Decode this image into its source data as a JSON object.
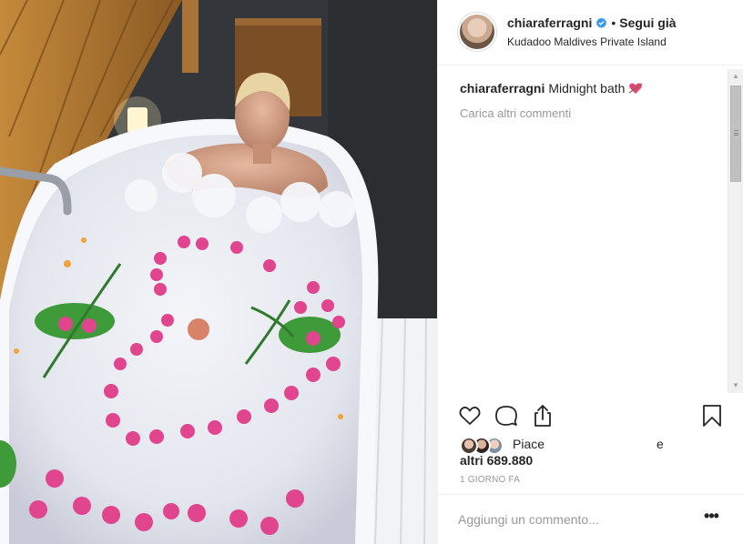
{
  "post": {
    "username": "chiaraferragni",
    "follow_separator": "•",
    "follow_label": "Segui già",
    "location": "Kudadoo Maldives Private Island",
    "caption_text": "Midnight bath",
    "load_more_label": "Carica altri commenti",
    "likes_text1": "Piace",
    "likes_e": "e",
    "likes_text2": "altri 689.880",
    "time_ago": "1 GIORNO FA",
    "comment_placeholder": "Aggiungi un commento...",
    "more_options": "•••"
  },
  "icons": {
    "verified": "verified-badge-icon",
    "like": "heart-outline-icon",
    "comment": "speech-bubble-icon",
    "share": "share-upload-icon",
    "save": "bookmark-icon",
    "caption_emoji": "heart-with-arrow-emoji"
  },
  "colors": {
    "verified_blue": "#3897f0",
    "text": "#262626",
    "muted": "#999999",
    "border": "#efefef"
  }
}
